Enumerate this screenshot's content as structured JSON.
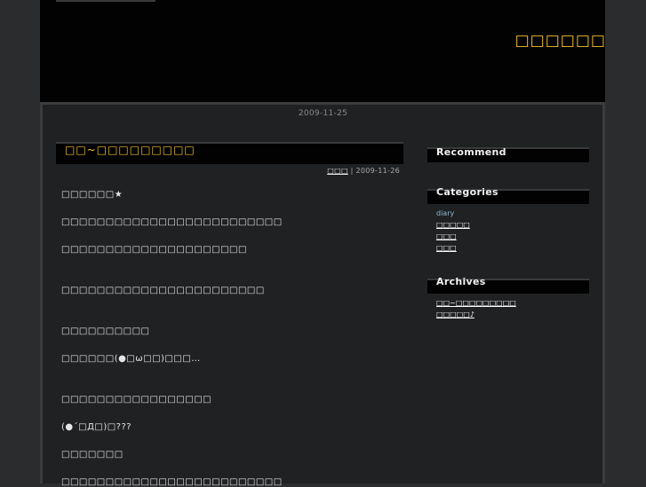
{
  "header": {
    "site_title": "□□□□□□"
  },
  "date_heading": "2009-11-25",
  "entry": {
    "title": "□□~□□□□□□□□□",
    "category_link": "□□□",
    "meta_separator": " | ",
    "date": "2009-11-26",
    "paragraphs": [
      "□□□□□□★",
      "□□□□□□□□□□□□□□□□□□□□□□□□□",
      "□□□□□□□□□□□□□□□□□□□□□",
      "□□□□□□□□□□□□□□□□□□□□□□□",
      "□□□□□□□□□□",
      "□□□□□□(●□ω□□)□□□…",
      "□□□□□□□□□□□□□□□□□",
      "(●´□Д□)□???",
      "□□□□□□□",
      "□□□□□□□□□□□□□□□□□□□□□□□□□"
    ]
  },
  "sidebar": {
    "recommend_heading": "Recommend",
    "categories_heading": "Categories",
    "categories": [
      "diary",
      "□□□□□",
      "□□□",
      "□□□"
    ],
    "archives_heading": "Archives",
    "archives": [
      "□□~□□□□□□□□□",
      "□□□□□♪"
    ]
  }
}
